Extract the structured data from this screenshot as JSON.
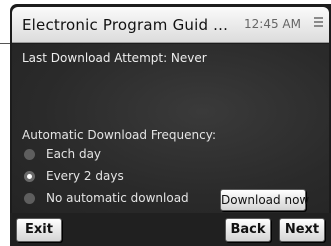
{
  "window": {
    "title": "Electronic Program Guid ...",
    "clock": "12:45 AM"
  },
  "status": {
    "last_download": "Last Download Attempt: Never"
  },
  "frequency": {
    "label": "Automatic Download Frequency:",
    "options": [
      {
        "label": "Each day",
        "selected": false
      },
      {
        "label": "Every 2 days",
        "selected": true
      },
      {
        "label": "No automatic download",
        "selected": false
      }
    ]
  },
  "actions": {
    "download_now": "Download now"
  },
  "bottom": {
    "exit": "Exit",
    "back": "Back",
    "next": "Next"
  },
  "colors": {
    "content_bg": "#2a2a2a",
    "titlebar_bg": "#f0f0f0",
    "text_light": "#e8e8e8"
  },
  "icons": {
    "menu": "hamburger-menu-icon"
  }
}
